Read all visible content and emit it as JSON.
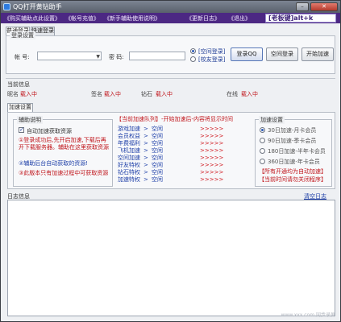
{
  "window": {
    "title": "QQ打开黄钻助手",
    "min_label": "–",
    "close_label": "✕"
  },
  "menu": {
    "items": [
      "《购买辅助点此设置》",
      "《帐号充值》",
      "《新手辅助使用说明》",
      "《更新日志》",
      "《退出》"
    ],
    "hotkey": "[老板键]alt+k"
  },
  "tabs": [
    "普通登录",
    "快速登录"
  ],
  "login": {
    "group_title": "登录设置",
    "account_label": "帐  号:",
    "password_label": "密  码:",
    "radio_options": [
      "[空间登录]",
      "[校友登录]"
    ],
    "buttons": [
      "登录QQ",
      "空间登录",
      "开始加速"
    ]
  },
  "status": {
    "section_title": "当前信息",
    "items": [
      {
        "label": "昵名",
        "value": "载入中"
      },
      {
        "label": "签名",
        "value": "载入中"
      },
      {
        "label": "钻石",
        "value": "载入中"
      },
      {
        "label": "在线",
        "value": "载入中"
      }
    ]
  },
  "panel_tab": "加速设置",
  "left_panel": {
    "title": "辅助说明",
    "checkbox_label": "自动加速获取资源",
    "notes": [
      "①登录成功后,先开启加速,下载后再开下载服务器。辅助在这里获取资源",
      "②辅助后台自动获取的资源!",
      "③此版本只有加速过程中可获取资源"
    ]
  },
  "middle_panel": {
    "header": "【当前加速队列】-开始加速后-内容将显示时间",
    "rows": [
      {
        "name": "游戏加速",
        "status": "空闲",
        "arrows": ">>>>>"
      },
      {
        "name": "会员权益",
        "status": "空闲",
        "arrows": ">>>>>"
      },
      {
        "name": "年费福利",
        "status": "空闲",
        "arrows": ">>>>>"
      },
      {
        "name": "飞机加速",
        "status": "空闲",
        "arrows": ">>>>>"
      },
      {
        "name": "空间加速",
        "status": "空闲",
        "arrows": ">>>>>"
      },
      {
        "name": "好友特权",
        "status": "空闲",
        "arrows": ">>>>>"
      },
      {
        "name": "钻石特权",
        "status": "空闲",
        "arrows": ">>>>>"
      },
      {
        "name": "加速特权",
        "status": "空闲",
        "arrows": ">>>>>"
      }
    ]
  },
  "right_panel": {
    "title": "加速设置",
    "options": [
      "30日加速-月卡会员",
      "90日加速-季卡会员",
      "180日加速-半年卡会员",
      "360日加速-年卡会员"
    ],
    "selected_index": 0,
    "notes": [
      "【所有开通均为自动加速】",
      "【当前时间请勿关闭程序】"
    ]
  },
  "log": {
    "title": "日志信息",
    "link": "清空日志"
  },
  "watermark": "www.xxx.com 同步录屏"
}
